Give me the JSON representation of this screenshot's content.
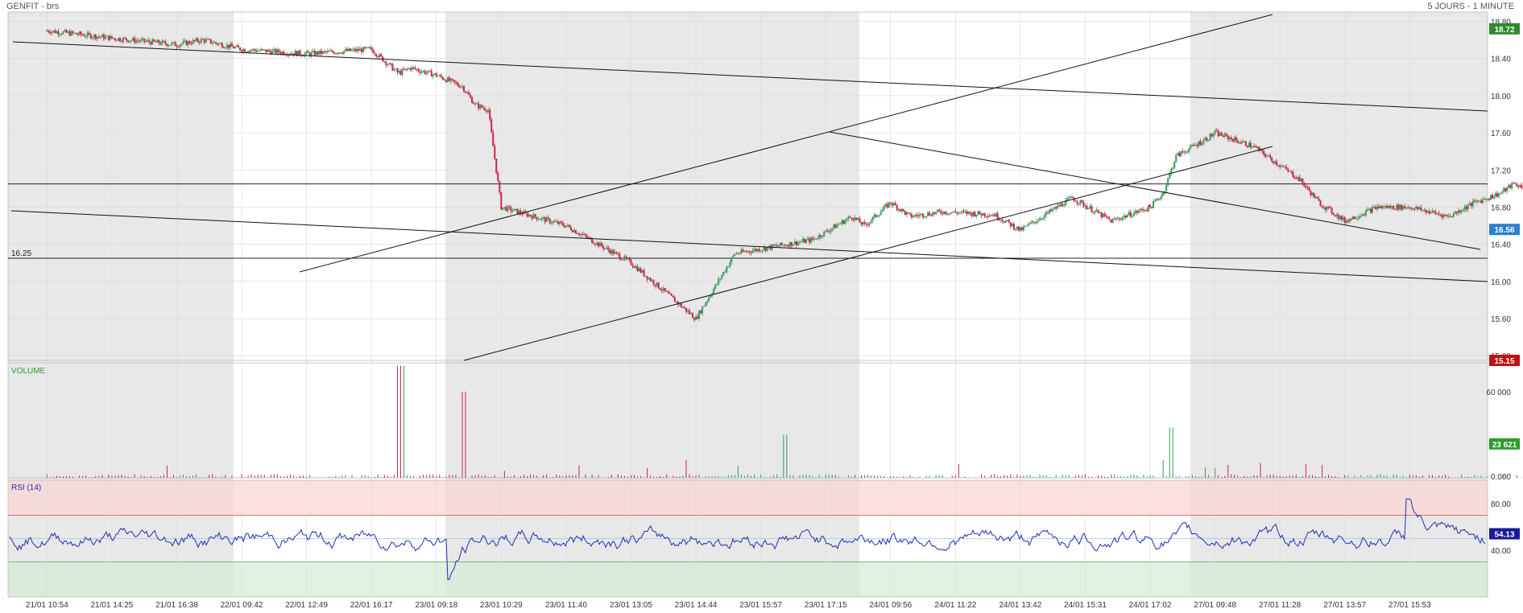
{
  "header": {
    "title": "GENFIT - brs",
    "period": "5 JOURS - 1 MINUTE"
  },
  "colors": {
    "up": "#3a9b5c",
    "down": "#c8254a",
    "session_shade": "#e8e8e8",
    "rsi_line": "#1f2fb4",
    "rsi_over": "#fbd5d5",
    "rsi_under": "#d7ecd7",
    "last_price_tag": "#2c7fd1",
    "high_tag": "#2e8b2e",
    "low_tag": "#c41010",
    "volume_tag": "#2e9b2e",
    "rsi_tag": "#1a1a9a"
  },
  "chart_data": [
    {
      "type": "line",
      "panel": "price",
      "ylim": [
        15.15,
        18.9
      ],
      "yticks": [
        "18.80",
        "18.40",
        "18.00",
        "17.60",
        "17.20",
        "16.80",
        "16.40",
        "16.00",
        "15.60",
        "15.20"
      ],
      "price_tags": {
        "last": "16.56",
        "high": "18.72",
        "low": "15.15"
      },
      "hline_label": "16.25",
      "hlines": [
        16.25,
        17.05
      ],
      "grid": true,
      "x_categories": [
        "21/01 10:54",
        "21/01 14:25",
        "21/01 16:38",
        "22/01 09:42",
        "22/01 12:49",
        "22/01 16:17",
        "23/01 09:18",
        "23/01 10:29",
        "23/01 11:40",
        "23/01 13:05",
        "23/01 14:44",
        "23/01 15:57",
        "23/01 17:15",
        "24/01 09:56",
        "24/01 11:22",
        "24/01 13:42",
        "24/01 15:31",
        "24/01 17:02",
        "27/01 09:48",
        "27/01 11:28",
        "27/01 13:57",
        "27/01 15:53"
      ],
      "series": [
        {
          "x": [
            0,
            1,
            2,
            2.4,
            3,
            4,
            5,
            5.4,
            5.45,
            5.6,
            6,
            6.4,
            6.6,
            6.8,
            7,
            8,
            9,
            10,
            10.6,
            11,
            11.8,
            12.4,
            12.6,
            13,
            13.3,
            13.8,
            14.6,
            15,
            15.8,
            16.4,
            17,
            17.2,
            17.4,
            17.9,
            18,
            18.6,
            19.3,
            19.6,
            20,
            20.5,
            21,
            21.6,
            22,
            22.4,
            22.6,
            22.9
          ],
          "y": [
            18.7,
            18.62,
            18.55,
            18.6,
            18.5,
            18.45,
            18.5,
            18.25,
            18.25,
            18.3,
            18.22,
            18.1,
            17.9,
            17.85,
            16.8,
            16.6,
            16.2,
            15.6,
            16.3,
            16.35,
            16.45,
            16.7,
            16.6,
            16.85,
            16.7,
            16.75,
            16.72,
            16.55,
            16.9,
            16.65,
            16.8,
            16.95,
            17.35,
            17.55,
            17.6,
            17.45,
            17.1,
            16.85,
            16.65,
            16.8,
            16.8,
            16.7,
            16.85,
            16.95,
            17.05,
            16.98
          ]
        }
      ]
    },
    {
      "type": "bar",
      "panel": "volume",
      "label": "VOLUME",
      "ylim": [
        0,
        80000
      ],
      "yticks": [
        "60 000",
        "0.000"
      ],
      "last_value": "23 621"
    },
    {
      "type": "line",
      "panel": "rsi",
      "label": "RSI (14)",
      "ylim": [
        0,
        100
      ],
      "yticks": [
        "80.00",
        "40.00"
      ],
      "overbought": 70,
      "oversold": 30,
      "last_value": "54.13"
    }
  ]
}
